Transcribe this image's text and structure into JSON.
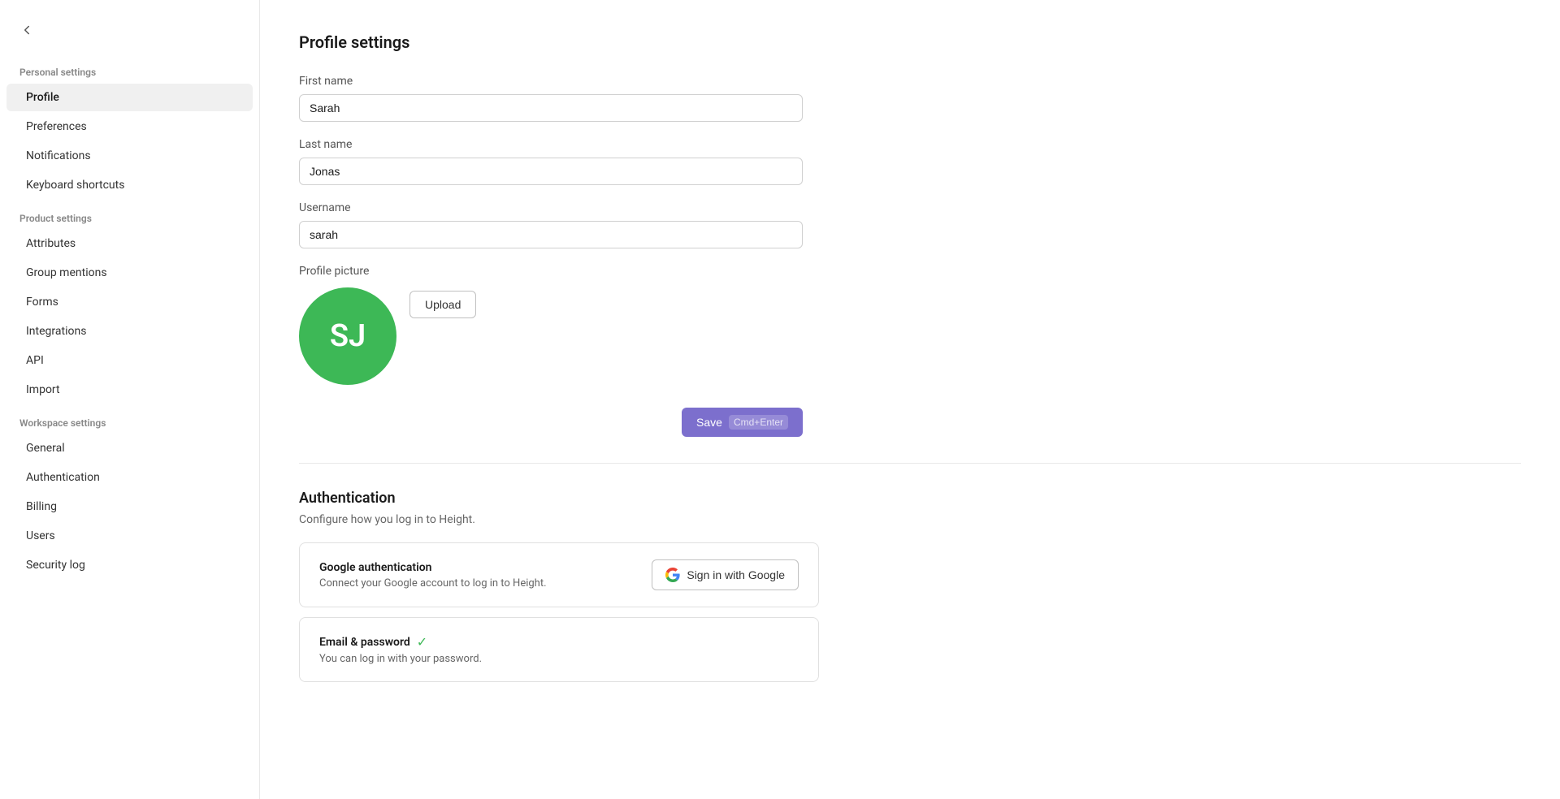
{
  "sidebar": {
    "back_label": "←",
    "personal_settings_label": "Personal settings",
    "items_personal": [
      {
        "id": "profile",
        "label": "Profile",
        "active": true
      },
      {
        "id": "preferences",
        "label": "Preferences",
        "active": false
      },
      {
        "id": "notifications",
        "label": "Notifications",
        "active": false
      },
      {
        "id": "keyboard-shortcuts",
        "label": "Keyboard shortcuts",
        "active": false
      }
    ],
    "product_settings_label": "Product settings",
    "items_product": [
      {
        "id": "attributes",
        "label": "Attributes",
        "active": false
      },
      {
        "id": "group-mentions",
        "label": "Group mentions",
        "active": false
      },
      {
        "id": "forms",
        "label": "Forms",
        "active": false
      },
      {
        "id": "integrations",
        "label": "Integrations",
        "active": false
      },
      {
        "id": "api",
        "label": "API",
        "active": false
      },
      {
        "id": "import",
        "label": "Import",
        "active": false
      }
    ],
    "workspace_settings_label": "Workspace settings",
    "items_workspace": [
      {
        "id": "general",
        "label": "General",
        "active": false
      },
      {
        "id": "authentication",
        "label": "Authentication",
        "active": false
      },
      {
        "id": "billing",
        "label": "Billing",
        "active": false
      },
      {
        "id": "users",
        "label": "Users",
        "active": false
      },
      {
        "id": "security-log",
        "label": "Security log",
        "active": false
      }
    ]
  },
  "main": {
    "page_title": "Profile settings",
    "form": {
      "first_name_label": "First name",
      "first_name_value": "Sarah",
      "last_name_label": "Last name",
      "last_name_value": "Jonas",
      "username_label": "Username",
      "username_value": "sarah",
      "profile_picture_label": "Profile picture",
      "avatar_initials": "SJ",
      "upload_button_label": "Upload",
      "save_button_label": "Save",
      "save_shortcut": "Cmd+Enter"
    },
    "authentication": {
      "title": "Authentication",
      "subtitle": "Configure how you log in to Height.",
      "google_card": {
        "title": "Google authentication",
        "description": "Connect your Google account to log in to Height.",
        "button_label": "Sign in with Google"
      },
      "email_card": {
        "title": "Email & password",
        "check": "✓",
        "description": "You can log in with your password."
      }
    }
  }
}
